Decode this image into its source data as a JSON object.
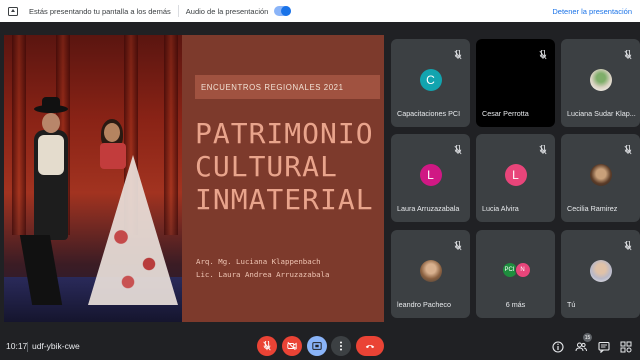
{
  "topbar": {
    "presenting_text": "Estás presentando tu pantalla a los demás",
    "audio_label": "Audio de la presentación",
    "stop_label": "Detener la presentación"
  },
  "slide": {
    "banner": "ENCUENTROS REGIONALES 2021",
    "title_lines": [
      "PATRIMONIO",
      "CULTURAL",
      "INMATERIAL"
    ],
    "authors": [
      "Arq. Mg. Luciana Klappenbach",
      "Lic. Laura Andrea Arruzazabala"
    ]
  },
  "participants": [
    {
      "name": "Capacitaciones PCI",
      "initial": "C",
      "color": "#12a4af",
      "type": "letter"
    },
    {
      "name": "Cesar Perrotta",
      "type": "dark"
    },
    {
      "name": "Luciana Sudar Klap...",
      "type": "photo"
    },
    {
      "name": "Laura Arruzazabala",
      "initial": "L",
      "color": "#d01884",
      "type": "letter"
    },
    {
      "name": "Lucia Alvira",
      "initial": "L",
      "color": "#e8457a",
      "type": "letter"
    },
    {
      "name": "Cecilia Ramirez",
      "type": "photo"
    },
    {
      "name": "leandro Pacheco",
      "type": "photo"
    },
    {
      "name": "6 más",
      "type": "more",
      "minis": [
        "PCI",
        "N"
      ]
    },
    {
      "name": "Tú",
      "type": "photo"
    }
  ],
  "bottombar": {
    "time": "10:17",
    "meeting_code": "udf-ybik-cwe",
    "participant_count": "15"
  },
  "colors": {
    "accent": "#8ab4f8",
    "danger": "#ea4335",
    "slide_bg": "#7d3a2c",
    "title": "#e9a48c"
  }
}
